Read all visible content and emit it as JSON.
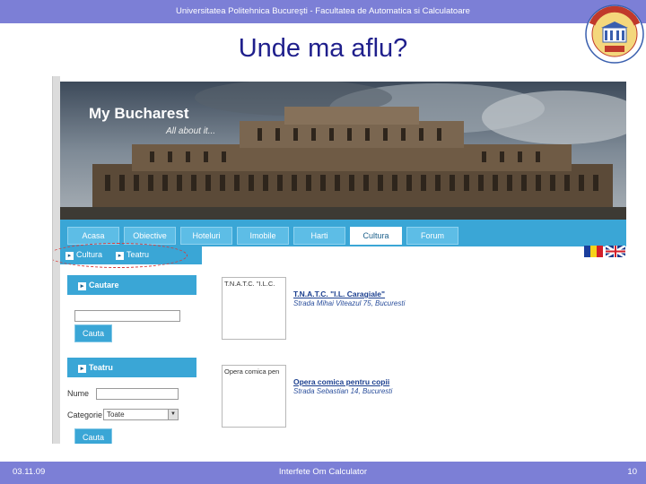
{
  "slide": {
    "header_text": "Universitatea Politehnica Bucureşti - Facultatea de Automatica si Calculatoare",
    "title": "Unde ma aflu?",
    "footer_date": "03.11.09",
    "footer_center": "Interfete Om Calculator",
    "page_number": "10",
    "logo_text_top": "POLITEHNICA",
    "logo_year": "1818"
  },
  "website": {
    "title": "My Bucharest",
    "subtitle": "All about it...",
    "nav_tabs": [
      {
        "label": "Acasa",
        "active": false
      },
      {
        "label": "Obiective",
        "active": false
      },
      {
        "label": "Hoteluri",
        "active": false
      },
      {
        "label": "Imobile",
        "active": false
      },
      {
        "label": "Harti",
        "active": false
      },
      {
        "label": "Cultura",
        "active": true
      },
      {
        "label": "Forum",
        "active": false
      }
    ],
    "subnav": [
      "Cultura",
      "Teatru"
    ],
    "search_panel": {
      "header": "Cautare",
      "button": "Cauta"
    },
    "theatre_panel": {
      "header": "Teatru",
      "name_label": "Nume",
      "category_label": "Categorie",
      "category_value": "Toate",
      "button": "Cauta"
    },
    "results": [
      {
        "thumb_text": "T.N.A.T.C. \"I.L.C.",
        "title": "T.N.A.T.C. \"I.L. Caragiale\"",
        "address": "Strada Mihai Viteazul 75, Bucuresti"
      },
      {
        "thumb_text": "Opera comica pen",
        "title": "Opera comica pentru copii",
        "address": "Strada Sebastian 14, Bucuresti"
      }
    ],
    "colors": {
      "accent": "#3aa6d6",
      "slide_bar": "#7c7fd6",
      "title": "#1f1f8c"
    }
  }
}
